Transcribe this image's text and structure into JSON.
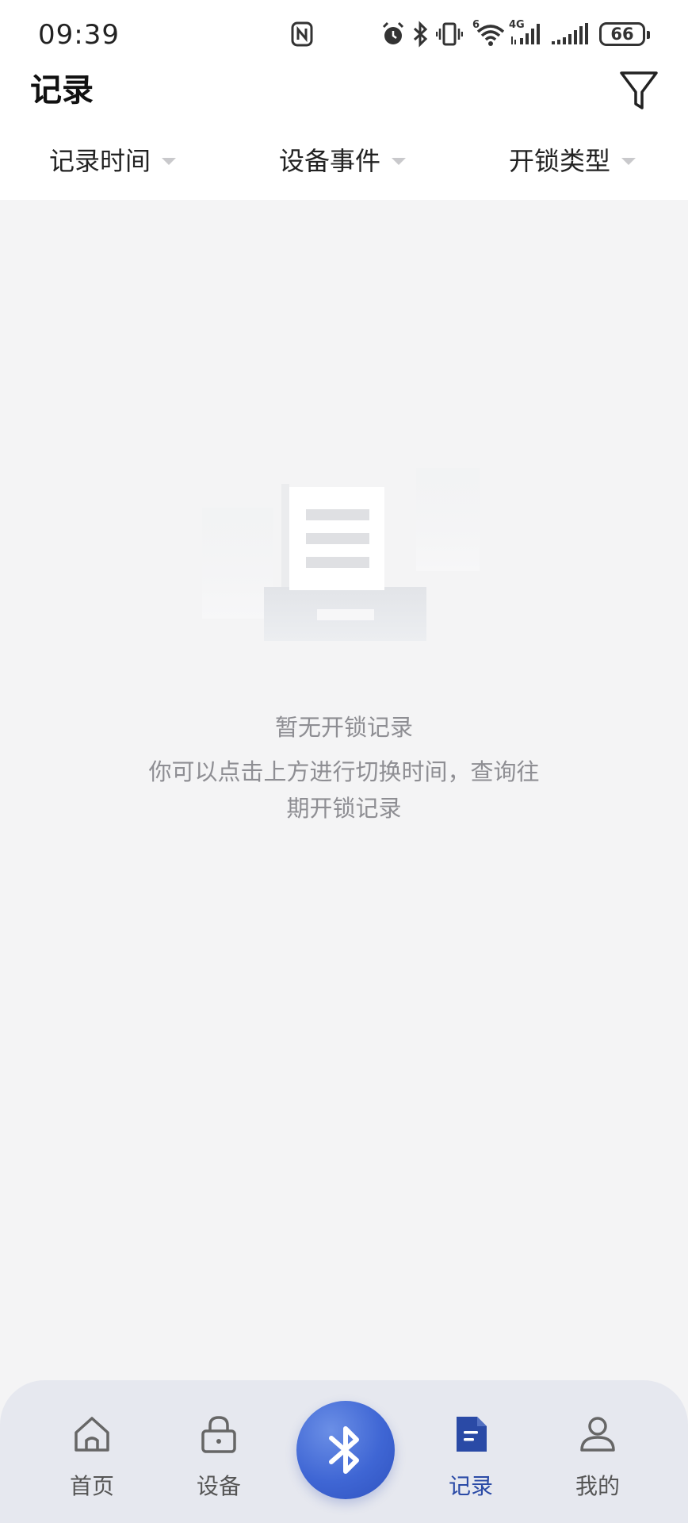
{
  "status_bar": {
    "time": "09:39",
    "battery": "66",
    "network": "4G",
    "network_slot": "6"
  },
  "header": {
    "title": "记录"
  },
  "filters": [
    {
      "label": "记录时间"
    },
    {
      "label": "设备事件"
    },
    {
      "label": "开锁类型"
    }
  ],
  "empty_state": {
    "title": "暂无开锁记录",
    "description": "你可以点击上方进行切换时间，查询往期开锁记录"
  },
  "bottom_nav": {
    "items": [
      {
        "label": "首页",
        "icon": "home-icon"
      },
      {
        "label": "设备",
        "icon": "lock-icon"
      },
      {
        "label": "记录",
        "icon": "document-icon"
      },
      {
        "label": "我的",
        "icon": "user-icon"
      }
    ],
    "center_icon": "bluetooth-icon",
    "active_color": "#2a4aa6",
    "center_color": "#3f66d4"
  }
}
